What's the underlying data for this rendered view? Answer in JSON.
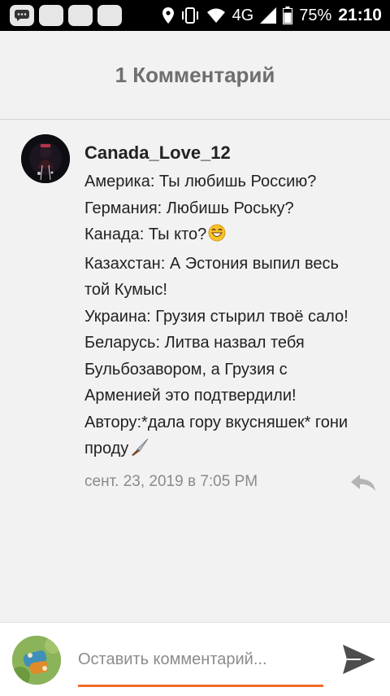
{
  "status_bar": {
    "network": "4G",
    "battery": "75%",
    "time": "21:10",
    "icons": [
      "message-app-icon",
      "app-icon",
      "app-icon",
      "app-icon",
      "location-icon",
      "vibrate-icon",
      "wifi-icon",
      "signal-icon",
      "battery-icon"
    ]
  },
  "header": {
    "title": "1 Комментарий"
  },
  "comment": {
    "username": "Canada_Love_12",
    "lines": [
      "Америка: Ты любишь Россию?",
      "Германия: Любишь Роську?",
      "Канада: Ты кто?",
      "Казахстан: А Эстония выпил весь",
      "той Кумыс!",
      "Украина: Грузия стырил твоё сало!",
      "Беларусь: Литва назвал тебя",
      "Бульбозавором, а Грузия с",
      "Арменией это подтвердили!",
      "Автору:*дала гору вкусняшек* гони",
      "проду"
    ],
    "timestamp": "сент. 23, 2019 в 7:05 PM",
    "reply_icon": "reply-icon",
    "emojis": [
      "grinning-face-emoji",
      "knife-emoji"
    ]
  },
  "input": {
    "placeholder": "Оставить комментарий...",
    "value": "",
    "send_icon": "send-icon",
    "accent_color": "#f06c2a"
  }
}
